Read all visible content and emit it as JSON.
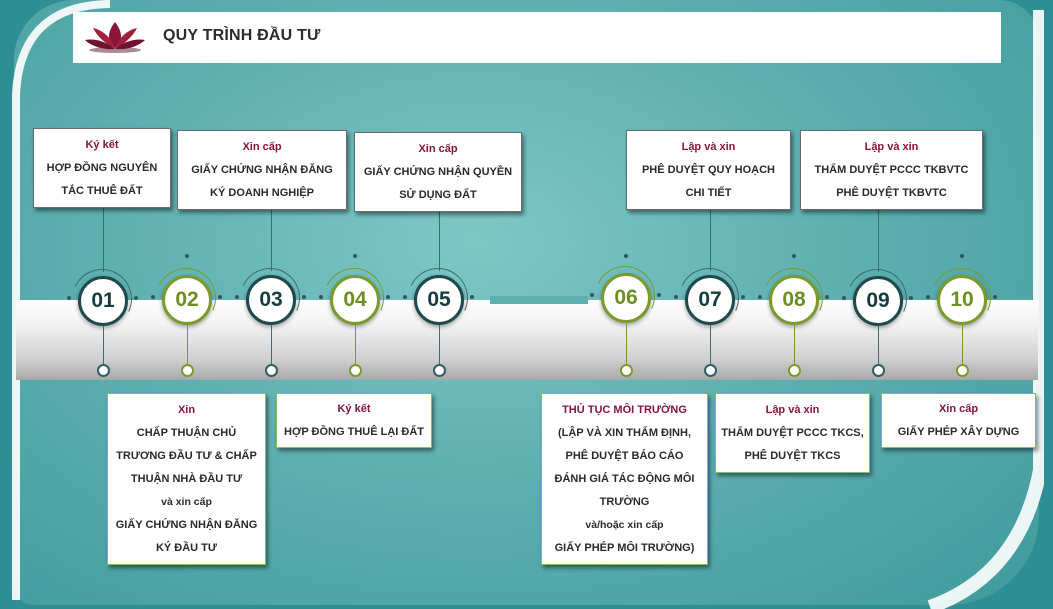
{
  "title": "QUY TRÌNH ĐẦU TƯ",
  "colors": {
    "accent_red": "#8a1538",
    "dark_teal": "#1e4a4e",
    "olive": "#7a9a2c",
    "background": "#5fb0b1"
  },
  "logo_icon": "lotus-icon",
  "steps": [
    {
      "num": "01",
      "color": "dark",
      "head": "Ký kết",
      "lines": [
        "HỢP ĐỒNG NGUYÊN",
        "TẮC THUÊ ĐẤT"
      ]
    },
    {
      "num": "02",
      "color": "green",
      "head": "Xin",
      "lines": [
        "CHẤP THUẬN CHỦ",
        "TRƯƠNG ĐẦU TƯ & CHẤP",
        "THUẬN NHÀ ĐẦU TƯ",
        "và xin cấp",
        "GIẤY CHỨNG NHẬN ĐĂNG",
        "KÝ ĐẦU TƯ"
      ]
    },
    {
      "num": "03",
      "color": "dark",
      "head": "Xin cấp",
      "lines": [
        "GIẤY CHỨNG NHẬN ĐĂNG",
        "KÝ DOANH NGHIỆP"
      ]
    },
    {
      "num": "04",
      "color": "green",
      "head": "Ký kết",
      "lines": [
        "HỢP ĐỒNG THUÊ LẠI ĐẤT"
      ]
    },
    {
      "num": "05",
      "color": "dark",
      "head": "Xin cấp",
      "lines": [
        "GIẤY CHỨNG NHẬN QUYỀN",
        "SỬ DỤNG ĐẤT"
      ]
    },
    {
      "num": "06",
      "color": "green",
      "head": "THỦ TỤC MÔI TRƯỜNG",
      "lines": [
        "(LẬP VÀ XIN THẨM ĐỊNH,",
        "PHÊ DUYỆT BÁO CÁO",
        "ĐÁNH GIÁ TÁC ĐỘNG MÔI",
        "TRƯỜNG",
        "và/hoặc xin cấp",
        "GIẤY PHÉP MÔI TRƯỜNG)"
      ]
    },
    {
      "num": "07",
      "color": "dark",
      "head": "Lập và xin",
      "lines": [
        "PHÊ DUYỆT QUY HOẠCH",
        "CHI TIẾT"
      ]
    },
    {
      "num": "08",
      "color": "green",
      "head": "Lập và xin",
      "lines": [
        "THẨM DUYỆT PCCC TKCS,",
        "PHÊ DUYỆT TKCS"
      ]
    },
    {
      "num": "09",
      "color": "dark",
      "head": "Lập và xin",
      "lines": [
        "THẨM DUYỆT PCCC TKBVTC",
        "PHÊ DUYỆT TKBVTC"
      ]
    },
    {
      "num": "10",
      "color": "green",
      "head": "Xin cấp",
      "lines": [
        "GIẤY PHÉP XÂY DỰNG"
      ]
    }
  ]
}
